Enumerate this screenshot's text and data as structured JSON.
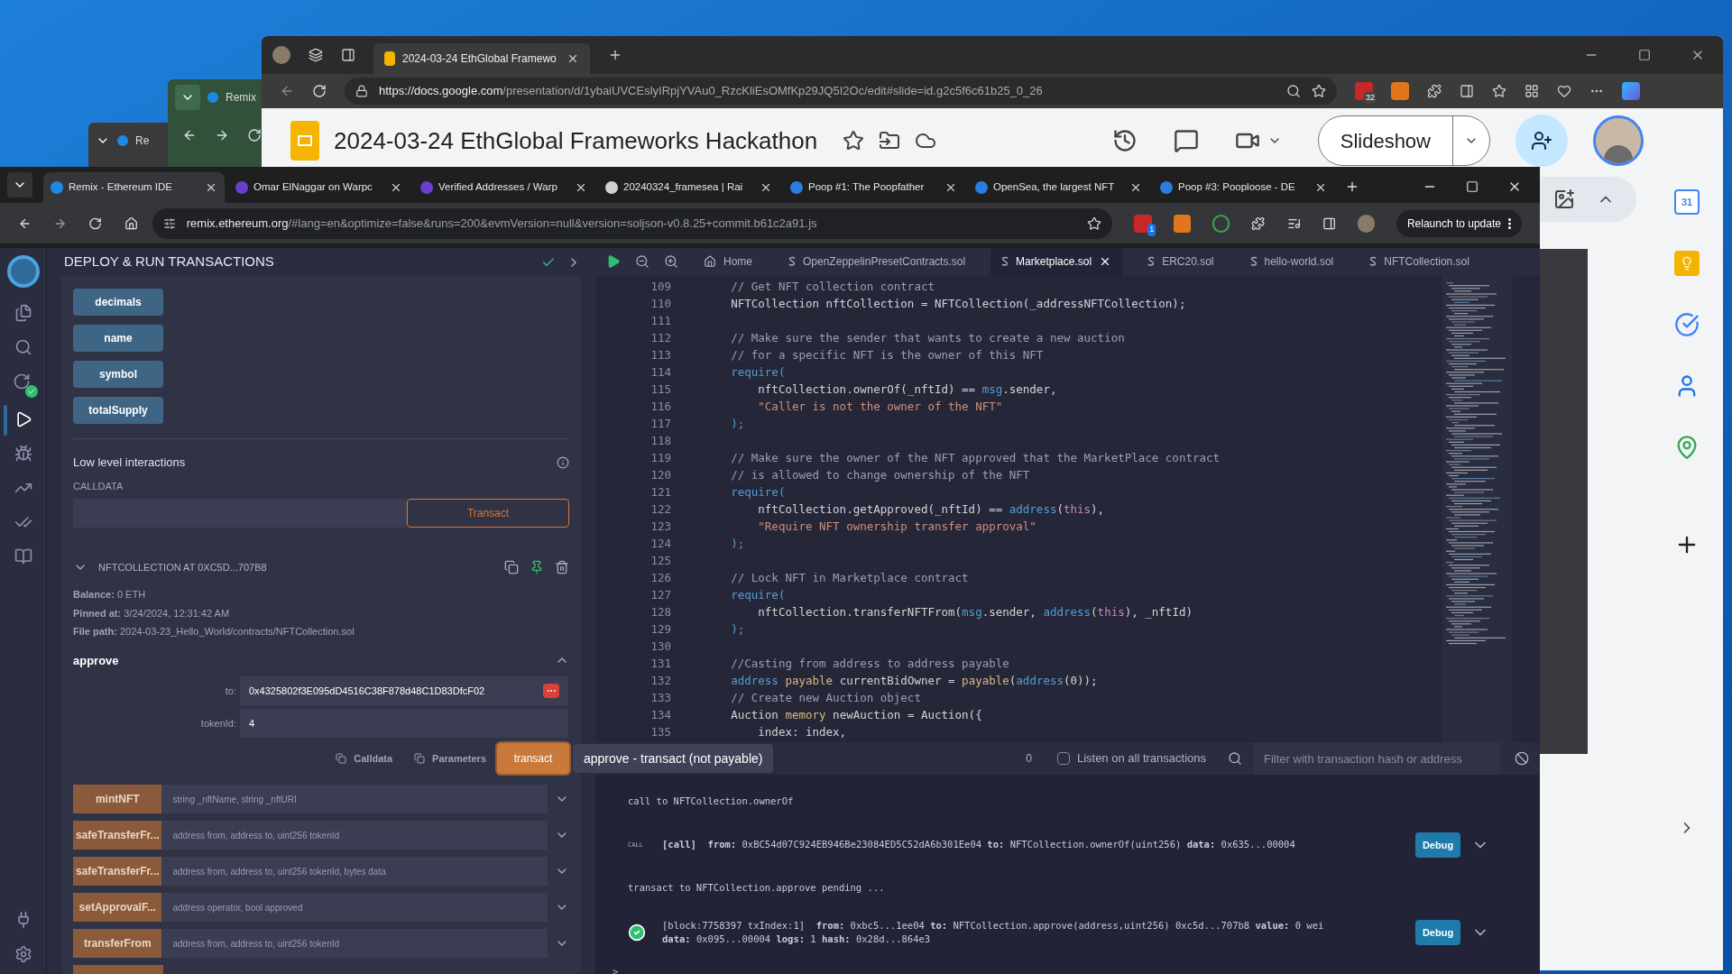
{
  "background_windows": [
    {
      "tab_label": "Remix"
    },
    {
      "tab_label": "Re"
    }
  ],
  "slides_browser": {
    "tab_title": "2024-03-24 EthGlobal Framewo",
    "url_host": "https://docs.google.com",
    "url_rest": "/presentation/d/1ybaiUVCEslyIRpjYVAu0_RzcKliEsOMfKp29JQ5I2Oc/edit#slide=id.g2c5f6c61b25_0_26",
    "extension_badge": "32",
    "doc_title": "2024-03-24 EthGlobal Frameworks Hackathon",
    "slideshow_button": "Slideshow",
    "calendar_day": "31"
  },
  "remix_browser": {
    "tabs": [
      {
        "label": "Remix - Ethereum IDE",
        "selected": true,
        "color": "#1e88e5"
      },
      {
        "label": "Omar ElNaggar on Warpc",
        "selected": false,
        "color": "#6a3fd0"
      },
      {
        "label": "Verified Addresses / Warp",
        "selected": false,
        "color": "#6a3fd0"
      },
      {
        "label": "20240324_framesea | Rai",
        "selected": false,
        "color": "#d0d0d0"
      },
      {
        "label": "Poop #1: The Poopfather",
        "selected": false,
        "color": "#2a7de1"
      },
      {
        "label": "OpenSea, the largest NFT",
        "selected": false,
        "color": "#2a7de1"
      },
      {
        "label": "Poop #3: Pooploose - DE",
        "selected": false,
        "color": "#2a7de1"
      }
    ],
    "url_host": "remix.ethereum.org",
    "url_rest": "/#lang=en&optimize=false&runs=200&evmVersion=null&version=soljson-v0.8.25+commit.b61c2a91.js",
    "extension_badge": "1",
    "relaunch_button": "Relaunch to update"
  },
  "side_panel": {
    "title": "DEPLOY & RUN TRANSACTIONS",
    "view_buttons": [
      "decimals",
      "name",
      "symbol",
      "totalSupply"
    ],
    "low_level": {
      "title": "Low level interactions",
      "calldata_label": "CALLDATA",
      "transact_button": "Transact"
    },
    "instance": {
      "title": "NFTCOLLECTION AT 0XC5D...707B8",
      "expanded": true,
      "balance_label": "Balance:",
      "balance": "0 ETH",
      "pinned_label": "Pinned at:",
      "pinned": "3/24/2024, 12:31:42 AM",
      "path_label": "File path:",
      "path": "2024-03-23_Hello_World/contracts/NFTCollection.sol"
    },
    "approve": {
      "name": "approve",
      "params": [
        {
          "label": "to:",
          "value": "0x4325802f3E095dD4516C38F878d48C1D83DfcF02"
        },
        {
          "label": "tokenId:",
          "value": "4"
        }
      ],
      "calldata_button": "Calldata",
      "parameters_button": "Parameters",
      "transact_button": "transact",
      "tooltip": "approve - transact (not payable)"
    },
    "functions": [
      {
        "name": "mintNFT",
        "signature": "string _nftName, string _nftURI"
      },
      {
        "name": "safeTransferFr...",
        "signature": "address from, address to, uint256 tokenId"
      },
      {
        "name": "safeTransferFr...",
        "signature": "address from, address to, uint256 tokenId, bytes data"
      },
      {
        "name": "setApprovalF...",
        "signature": "address operator, bool approved"
      },
      {
        "name": "transferFrom",
        "signature": "address from, address to, uint256 tokenId"
      }
    ]
  },
  "editor": {
    "tabs": [
      {
        "label": "Home",
        "kind": "home",
        "selected": false
      },
      {
        "label": "OpenZeppelinPresetContracts.sol",
        "kind": "file",
        "selected": false
      },
      {
        "label": "Marketplace.sol",
        "kind": "file",
        "selected": true
      },
      {
        "label": "ERC20.sol",
        "kind": "file",
        "selected": false
      },
      {
        "label": "hello-world.sol",
        "kind": "file",
        "selected": false
      },
      {
        "label": "NFTCollection.sol",
        "kind": "file",
        "selected": false
      }
    ],
    "lines": [
      {
        "number": "109",
        "tokens": [
          {
            "text": "        // Get NFT collection contract",
            "kind": "comment"
          }
        ]
      },
      {
        "number": "110",
        "tokens": [
          {
            "text": "        NFTCollection nftCollection = NFTCollection(_addressNFTCollection);",
            "kind": "plain"
          }
        ]
      },
      {
        "number": "111"
      },
      {
        "number": "112",
        "tokens": [
          {
            "text": "        // Make sure the sender that wants to create a new auction",
            "kind": "comment"
          }
        ]
      },
      {
        "number": "113",
        "tokens": [
          {
            "text": "        // for a specific NFT is the owner of this NFT",
            "kind": "comment"
          }
        ]
      },
      {
        "number": "114",
        "tokens": [
          {
            "text": "        require(",
            "kind": "keyword"
          }
        ]
      },
      {
        "number": "115",
        "tokens": [
          {
            "text": "            nftCollection.ownerOf(_nftId) == ",
            "kind": "plain"
          },
          {
            "text": "msg",
            "kind": "keyword"
          },
          {
            "text": ".sender,",
            "kind": "plain"
          }
        ]
      },
      {
        "number": "116",
        "tokens": [
          {
            "text": "            \"Caller is not the owner of the NFT\"",
            "kind": "string"
          }
        ]
      },
      {
        "number": "117",
        "tokens": [
          {
            "text": "        );",
            "kind": "keyword"
          }
        ]
      },
      {
        "number": "118"
      },
      {
        "number": "119",
        "tokens": [
          {
            "text": "        // Make sure the owner of the NFT approved that the MarketPlace contract",
            "kind": "comment"
          }
        ]
      },
      {
        "number": "120",
        "tokens": [
          {
            "text": "        // is allowed to change ownership of the NFT",
            "kind": "comment"
          }
        ]
      },
      {
        "number": "121",
        "tokens": [
          {
            "text": "        require(",
            "kind": "keyword"
          }
        ]
      },
      {
        "number": "122",
        "tokens": [
          {
            "text": "            nftCollection.getApproved(_nftId) == ",
            "kind": "plain"
          },
          {
            "text": "address",
            "kind": "keyword"
          },
          {
            "text": "(",
            "kind": "plain"
          },
          {
            "text": "this",
            "kind": "special"
          },
          {
            "text": "),",
            "kind": "plain"
          }
        ]
      },
      {
        "number": "123",
        "tokens": [
          {
            "text": "            \"Require NFT ownership transfer approval\"",
            "kind": "string"
          }
        ]
      },
      {
        "number": "124",
        "tokens": [
          {
            "text": "        );",
            "kind": "keyword"
          }
        ]
      },
      {
        "number": "125"
      },
      {
        "number": "126",
        "tokens": [
          {
            "text": "        // Lock NFT in Marketplace contract",
            "kind": "comment"
          }
        ]
      },
      {
        "number": "127",
        "tokens": [
          {
            "text": "        require(",
            "kind": "keyword"
          }
        ]
      },
      {
        "number": "128",
        "tokens": [
          {
            "text": "            nftCollection.transferNFTFrom(",
            "kind": "plain"
          },
          {
            "text": "msg",
            "kind": "keyword"
          },
          {
            "text": ".sender, ",
            "kind": "plain"
          },
          {
            "text": "address",
            "kind": "keyword"
          },
          {
            "text": "(",
            "kind": "plain"
          },
          {
            "text": "this",
            "kind": "special"
          },
          {
            "text": "), _nftId)",
            "kind": "plain"
          }
        ]
      },
      {
        "number": "129",
        "tokens": [
          {
            "text": "        );",
            "kind": "keyword"
          }
        ]
      },
      {
        "number": "130"
      },
      {
        "number": "131",
        "tokens": [
          {
            "text": "        //Casting from address to address payable",
            "kind": "comment"
          }
        ]
      },
      {
        "number": "132",
        "tokens": [
          {
            "text": "        address ",
            "kind": "keyword"
          },
          {
            "text": "payable",
            "kind": "type"
          },
          {
            "text": " currentBidOwner = ",
            "kind": "plain"
          },
          {
            "text": "payable",
            "kind": "type"
          },
          {
            "text": "(",
            "kind": "plain"
          },
          {
            "text": "address",
            "kind": "keyword"
          },
          {
            "text": "(0));",
            "kind": "plain"
          }
        ]
      },
      {
        "number": "133",
        "tokens": [
          {
            "text": "        // Create new Auction object",
            "kind": "comment"
          }
        ]
      },
      {
        "number": "134",
        "tokens": [
          {
            "text": "        Auction ",
            "kind": "plain"
          },
          {
            "text": "memory",
            "kind": "type"
          },
          {
            "text": " newAuction = Auction({",
            "kind": "plain"
          }
        ]
      },
      {
        "number": "135",
        "tokens": [
          {
            "text": "            index: index,",
            "kind": "plain"
          }
        ]
      }
    ]
  },
  "terminal": {
    "count": "0",
    "listen_label": "Listen on all transactions",
    "listen_checked": false,
    "filter_placeholder": "Filter with transaction hash or address",
    "entries": [
      {
        "kind": "text",
        "lines": [
          "call to NFTCollection.ownerOf"
        ]
      },
      {
        "kind": "call",
        "badge": "CALL",
        "lines": [
          "**[call]**  **from:** 0xBC54d07C924EB946Be23084ED5C52dA6b301Ee04 **to:** NFTCollection.ownerOf(uint256) **data:** 0x635...00004"
        ],
        "debug": "Debug"
      },
      {
        "kind": "text",
        "lines": [
          "transact to NFTCollection.approve pending ..."
        ]
      },
      {
        "kind": "success",
        "lines": [
          "[block:7758397 txIndex:1]  **from:** 0xbc5...1ee04 **to:** NFTCollection.approve(address,uint256) 0xc5d...707b8 **value:** 0 wei",
          "**data:** 0x095...00004 **logs:** 1 **hash:** 0x28d...864e3"
        ],
        "debug": "Debug"
      }
    ],
    "prompt": ">"
  }
}
